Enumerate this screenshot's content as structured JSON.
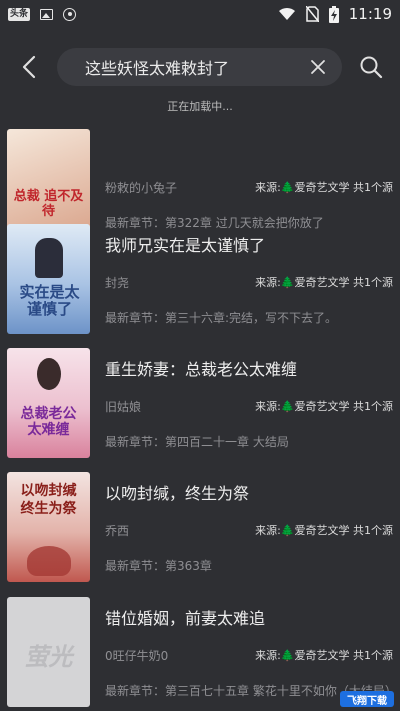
{
  "status_bar": {
    "badge": "头条",
    "time": "11:19"
  },
  "search": {
    "query": "这些妖怪太难敕封了",
    "loading": "正在加载中..."
  },
  "colors": {
    "background": "#2e2f33",
    "search_bg": "#3b3c41",
    "muted_text": "#8f8f93",
    "source_tree": "#6a8f3a"
  },
  "books": [
    {
      "title": "",
      "author": "粉敕的小兔子",
      "source": "来源:🌲爱奇艺文学 共1个源",
      "latest": "最新章节：第322章 过几天就会把你放了",
      "cover_text": "总裁 追不及待",
      "cover_palette": [
        "#f5e7da",
        "#d9a38a"
      ]
    },
    {
      "title": "我师兄实在是太谨慎了",
      "author": "封尧",
      "source": "来源:🌲爱奇艺文学 共1个源",
      "latest": "最新章节：第三十六章:完结，写不下去了。",
      "cover_text": "实在是太谨慎了",
      "cover_palette": [
        "#dfeaf5",
        "#6d93c8"
      ]
    },
    {
      "title": "重生娇妻：总裁老公太难缠",
      "author": "旧姑娘",
      "source": "来源:🌲爱奇艺文学 共1个源",
      "latest": "最新章节：第四百二十一章 大结局",
      "cover_text": "总裁老公 太难缠",
      "cover_palette": [
        "#f7e3ea",
        "#d9829d"
      ]
    },
    {
      "title": "以吻封缄，终生为祭",
      "author": "乔西",
      "source": "来源:🌲爱奇艺文学 共1个源",
      "latest": "最新章节：第363章",
      "cover_text": "以吻封缄 终生为祭",
      "cover_palette": [
        "#f3e4e1",
        "#c0584f"
      ]
    },
    {
      "title": "错位婚姻，前妻太难追",
      "author": "0旺仔牛奶0",
      "source": "来源:🌲爱奇艺文学 共1个源",
      "latest": "最新章节：第三百七十五章 繁花十里不如你（大结局）",
      "cover_text": "萤光",
      "cover_palette": [
        "#d7d7d9",
        "#c7c7ca"
      ]
    }
  ],
  "watermark": "飞翔下载"
}
